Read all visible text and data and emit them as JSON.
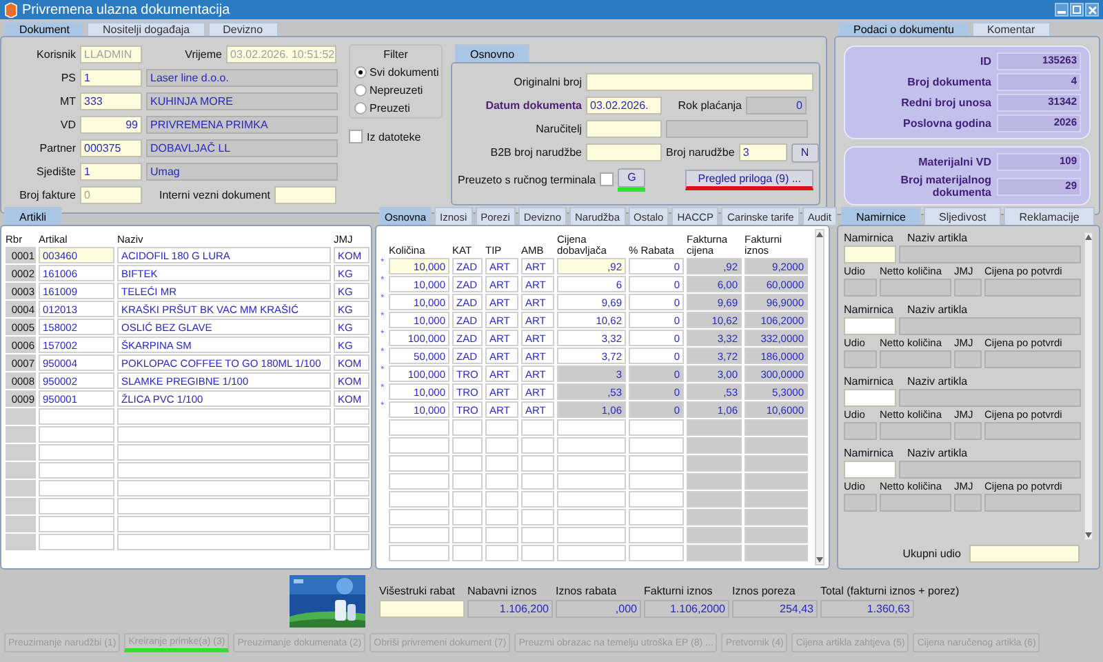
{
  "window": {
    "title": "Privremena ulazna dokumentacija"
  },
  "doc_tabs": [
    {
      "label": "Dokument",
      "selected": true
    },
    {
      "label": "Nositelji događaja",
      "selected": false
    },
    {
      "label": "Devizno",
      "selected": false
    }
  ],
  "korisnik": {
    "label": "Korisnik",
    "value": "LLADMIN"
  },
  "vrijeme": {
    "label": "Vrijeme",
    "value": "03.02.2026. 10:51:52"
  },
  "codes": [
    {
      "label": "PS",
      "code": "1",
      "name": "Laser line d.o.o."
    },
    {
      "label": "MT",
      "code": "333",
      "name": "KUHINJA  MORE"
    },
    {
      "label": "VD",
      "code": "99",
      "name": "PRIVREMENA PRIMKA"
    },
    {
      "label": "Partner",
      "code": "000375",
      "name": "DOBAVLJAČ LL"
    },
    {
      "label": "Sjedište",
      "code": "1",
      "name": "Umag"
    }
  ],
  "broj_fakture": {
    "label": "Broj fakture",
    "value": "0"
  },
  "interni": {
    "label": "Interni vezni dokument"
  },
  "filter": {
    "title": "Filter",
    "options": [
      {
        "label": "Svi dokumenti",
        "selected": true
      },
      {
        "label": "Nepreuzeti",
        "selected": false
      },
      {
        "label": "Preuzeti",
        "selected": false
      }
    ]
  },
  "iz_datoteke": {
    "label": "Iz datoteke",
    "checked": false
  },
  "osnovno": {
    "tab": {
      "label": "Osnovno",
      "selected": true
    },
    "originalni_broj": "Originalni broj",
    "datum": {
      "label": "Datum dokumenta",
      "value": "03.02.2026."
    },
    "rok": {
      "label": "Rok plaćanja",
      "value": "0"
    },
    "narucitelj": "Naručitelj",
    "b2b": "B2B broj narudžbe",
    "broj_narudzbe": {
      "label": "Broj narudžbe",
      "value": "3"
    },
    "n_button": "N",
    "preuzeto": {
      "label": "Preuzeto s ručnog terminala",
      "checked": false
    },
    "g_button": {
      "label": "G",
      "color": "#33dd33"
    },
    "pregled_button": {
      "label": "Pregled priloga (9) ...",
      "color": "#dd1111"
    }
  },
  "info_tabs": [
    {
      "label": "Podaci o dokumentu",
      "selected": true
    },
    {
      "label": "Komentar",
      "selected": false
    }
  ],
  "info_groups": [
    [
      {
        "label": "ID",
        "value": "135263"
      },
      {
        "label": "Broj dokumenta",
        "value": "4"
      },
      {
        "label": "Redni broj unosa",
        "value": "31342"
      },
      {
        "label": "Poslovna godina",
        "value": "2026"
      }
    ],
    [
      {
        "label": "Materijalni VD",
        "value": "109"
      },
      {
        "label": "Broj materijalnog dokumenta",
        "value": "29"
      }
    ]
  ],
  "artikli": {
    "tab": "Artikli",
    "columns": [
      "Rbr",
      "Artikal",
      "Naziv",
      "JMJ"
    ],
    "rows": [
      {
        "rbr": "0001",
        "artikal": "003460",
        "naziv": "ACIDOFIL 180 G LURA",
        "jmj": "KOM",
        "selected": true
      },
      {
        "rbr": "0002",
        "artikal": "161006",
        "naziv": " BIFTEK",
        "jmj": "KG",
        "selected": false
      },
      {
        "rbr": "0003",
        "artikal": "161009",
        "naziv": "TELEĆI MR",
        "jmj": "KG",
        "selected": false
      },
      {
        "rbr": "0004",
        "artikal": "012013",
        "naziv": "KRAŠKI PRŠUT BK VAC MM KRAŠIĆ",
        "jmj": "KG",
        "selected": false
      },
      {
        "rbr": "0005",
        "artikal": "158002",
        "naziv": "OSLIĆ BEZ GLAVE",
        "jmj": "KG",
        "selected": false
      },
      {
        "rbr": "0006",
        "artikal": "157002",
        "naziv": "ŠKARPINA SM",
        "jmj": "KG",
        "selected": false
      },
      {
        "rbr": "0007",
        "artikal": "950004",
        "naziv": "POKLOPAC COFFEE TO GO 180ML 1/100",
        "jmj": "KOM",
        "selected": false
      },
      {
        "rbr": "0008",
        "artikal": "950002",
        "naziv": "SLAMKE PREGIBNE 1/100",
        "jmj": "KOM",
        "selected": false
      },
      {
        "rbr": "0009",
        "artikal": "950001",
        "naziv": "ŽLICA PVC 1/100",
        "jmj": "KOM",
        "selected": false
      }
    ]
  },
  "detail_tabs": [
    {
      "label": "Osnovna",
      "selected": true
    },
    {
      "label": "Iznosi",
      "selected": false
    },
    {
      "label": "Porezi",
      "selected": false
    },
    {
      "label": "Devizno",
      "selected": false
    },
    {
      "label": "Narudžba",
      "selected": false
    },
    {
      "label": "Ostalo",
      "selected": false
    },
    {
      "label": "HACCP",
      "selected": false
    },
    {
      "label": "Carinske tarife",
      "selected": false
    },
    {
      "label": "Audit",
      "selected": false
    }
  ],
  "detail_columns": [
    "Količina",
    "KAT",
    "TIP",
    "AMB",
    "Cijena dobavljača",
    "% Rabata",
    "Fakturna cijena",
    "Fakturni iznos"
  ],
  "detail_rows": [
    {
      "mark": "*",
      "kolicina": "10,000",
      "kat": "ZAD",
      "tip": "ART",
      "amb": "ART",
      "cijena": ",92",
      "rabat": "0",
      "fakturna": ",92",
      "iznos": "9,2000",
      "selected": true,
      "price_locked": false
    },
    {
      "mark": "*",
      "kolicina": "10,000",
      "kat": "ZAD",
      "tip": "ART",
      "amb": "ART",
      "cijena": "6",
      "rabat": "0",
      "fakturna": "6,00",
      "iznos": "60,0000",
      "selected": false,
      "price_locked": false
    },
    {
      "mark": "*",
      "kolicina": "10,000",
      "kat": "ZAD",
      "tip": "ART",
      "amb": "ART",
      "cijena": "9,69",
      "rabat": "0",
      "fakturna": "9,69",
      "iznos": "96,9000",
      "selected": false,
      "price_locked": false
    },
    {
      "mark": "*",
      "kolicina": "10,000",
      "kat": "ZAD",
      "tip": "ART",
      "amb": "ART",
      "cijena": "10,62",
      "rabat": "0",
      "fakturna": "10,62",
      "iznos": "106,2000",
      "selected": false,
      "price_locked": false
    },
    {
      "mark": "*",
      "kolicina": "100,000",
      "kat": "ZAD",
      "tip": "ART",
      "amb": "ART",
      "cijena": "3,32",
      "rabat": "0",
      "fakturna": "3,32",
      "iznos": "332,0000",
      "selected": false,
      "price_locked": false
    },
    {
      "mark": "*",
      "kolicina": "50,000",
      "kat": "ZAD",
      "tip": "ART",
      "amb": "ART",
      "cijena": "3,72",
      "rabat": "0",
      "fakturna": "3,72",
      "iznos": "186,0000",
      "selected": false,
      "price_locked": false
    },
    {
      "mark": "*",
      "kolicina": "100,000",
      "kat": "TRO",
      "tip": "ART",
      "amb": "ART",
      "cijena": "3",
      "rabat": "0",
      "fakturna": "3,00",
      "iznos": "300,0000",
      "selected": false,
      "price_locked": true
    },
    {
      "mark": "*",
      "kolicina": "10,000",
      "kat": "TRO",
      "tip": "ART",
      "amb": "ART",
      "cijena": ",53",
      "rabat": "0",
      "fakturna": ",53",
      "iznos": "5,3000",
      "selected": false,
      "price_locked": true
    },
    {
      "mark": "*",
      "kolicina": "10,000",
      "kat": "TRO",
      "tip": "ART",
      "amb": "ART",
      "cijena": "1,06",
      "rabat": "0",
      "fakturna": "1,06",
      "iznos": "10,6000",
      "selected": false,
      "price_locked": true
    }
  ],
  "namirnice": {
    "tabs": [
      {
        "label": "Namirnice",
        "selected": true
      },
      {
        "label": "Sljedivost",
        "selected": false
      },
      {
        "label": "Reklamacije",
        "selected": false
      }
    ],
    "blocks": [
      {
        "namirnica": "Namirnica",
        "naziv": "Naziv artikla",
        "udio": "Udio",
        "netto": "Netto količina",
        "jmj": "JMJ",
        "cijena": "Cijena po potvrdi",
        "selected": true
      },
      {
        "namirnica": "Namirnica",
        "naziv": "Naziv artikla",
        "udio": "Udio",
        "netto": "Netto količina",
        "jmj": "JMJ",
        "cijena": "Cijena po potvrdi",
        "selected": false
      },
      {
        "namirnica": "Namirnica",
        "naziv": "Naziv artikla",
        "udio": "Udio",
        "netto": "Netto količina",
        "jmj": "JMJ",
        "cijena": "Cijena po potvrdi",
        "selected": false
      },
      {
        "namirnica": "Namirnica",
        "naziv": "Naziv artikla",
        "udio": "Udio",
        "netto": "Netto količina",
        "jmj": "JMJ",
        "cijena": "Cijena po potvrdi",
        "selected": false
      }
    ],
    "ukupni": "Ukupni udio"
  },
  "totals": [
    {
      "label": "Višestruki rabat"
    },
    {
      "label": "Nabavni iznos",
      "value": "1.106,200"
    },
    {
      "label": "Iznos rabata",
      "value": ",000"
    },
    {
      "label": "Fakturni iznos",
      "value": "1.106,2000"
    },
    {
      "label": "Iznos poreza",
      "value": "254,43"
    },
    {
      "label": "Total (fakturni iznos + porez)",
      "value": "1.360,63"
    }
  ],
  "buttons": [
    {
      "label": "Preuzimanje narudžbi (1)",
      "disabled": true
    },
    {
      "label": "Kreiranje primke(a) (3)",
      "disabled": true,
      "color": "#33dd33"
    },
    {
      "label": "Preuzimanje dokumenata (2)",
      "disabled": true
    },
    {
      "label": "Obriši privremeni dokument (7)",
      "disabled": true
    },
    {
      "label": "Preuzmi obrazac na temelju utroška EP (8) ...",
      "disabled": true
    },
    {
      "label": "Pretvornik (4)",
      "disabled": true
    },
    {
      "label": "Cijena artikla zahtjeva (5)",
      "disabled": true
    },
    {
      "label": "Cijena naručenog artikla (6)",
      "disabled": true
    }
  ]
}
